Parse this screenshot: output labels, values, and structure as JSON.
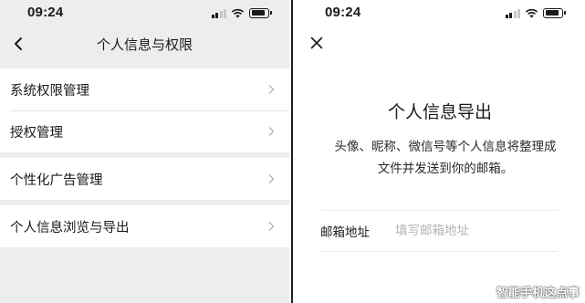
{
  "left_screen": {
    "status_time": "09:24",
    "title": "个人信息与权限",
    "groups": [
      {
        "items": [
          {
            "label": "系统权限管理"
          },
          {
            "label": "授权管理"
          }
        ]
      },
      {
        "items": [
          {
            "label": "个性化广告管理"
          }
        ]
      },
      {
        "items": [
          {
            "label": "个人信息浏览与导出"
          }
        ]
      }
    ]
  },
  "right_screen": {
    "status_time": "09:24",
    "title": "个人信息导出",
    "description_line1": "头像、昵称、微信号等个人信息将整理成",
    "description_line2": "文件并发送到你的邮箱。",
    "email_label": "邮箱地址",
    "email_placeholder": "填写邮箱地址",
    "email_value": ""
  },
  "watermark": "智能手机这点事",
  "icons": {
    "back": "chevron-left-icon",
    "close": "close-icon",
    "row_arrow": "chevron-right-icon",
    "signal": "cellular-signal-icon",
    "wifi": "wifi-icon",
    "battery": "battery-icon"
  },
  "colors": {
    "left_background": "#ededed",
    "row_background": "#ffffff",
    "text": "#1a1a1a",
    "placeholder": "#b3b3b3"
  }
}
